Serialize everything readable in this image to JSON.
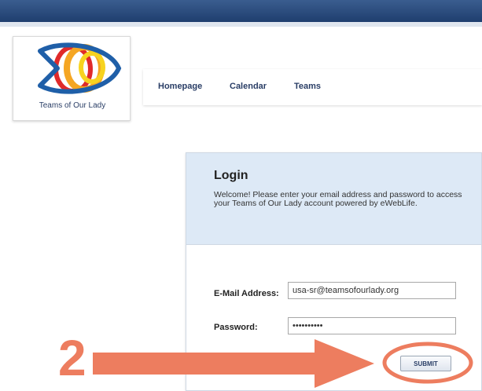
{
  "logo": {
    "text": "Teams of Our Lady"
  },
  "nav": [
    {
      "label": "Homepage"
    },
    {
      "label": "Calendar"
    },
    {
      "label": "Teams"
    }
  ],
  "login": {
    "title": "Login",
    "description": "Welcome! Please enter your email address and password to access your Teams of Our Lady account powered by eWebLife.",
    "email_label": "E-Mail Address:",
    "email_value": "usa-sr@teamsofourlady.org",
    "password_label": "Password:",
    "password_value": "••••••••••",
    "submit_label": "SUBMIT"
  },
  "annotation": {
    "step_number": "2",
    "accent_color": "#ed7d5f"
  },
  "colors": {
    "header_blue": "#1f3e6e",
    "panel_blue": "#dde9f6"
  }
}
